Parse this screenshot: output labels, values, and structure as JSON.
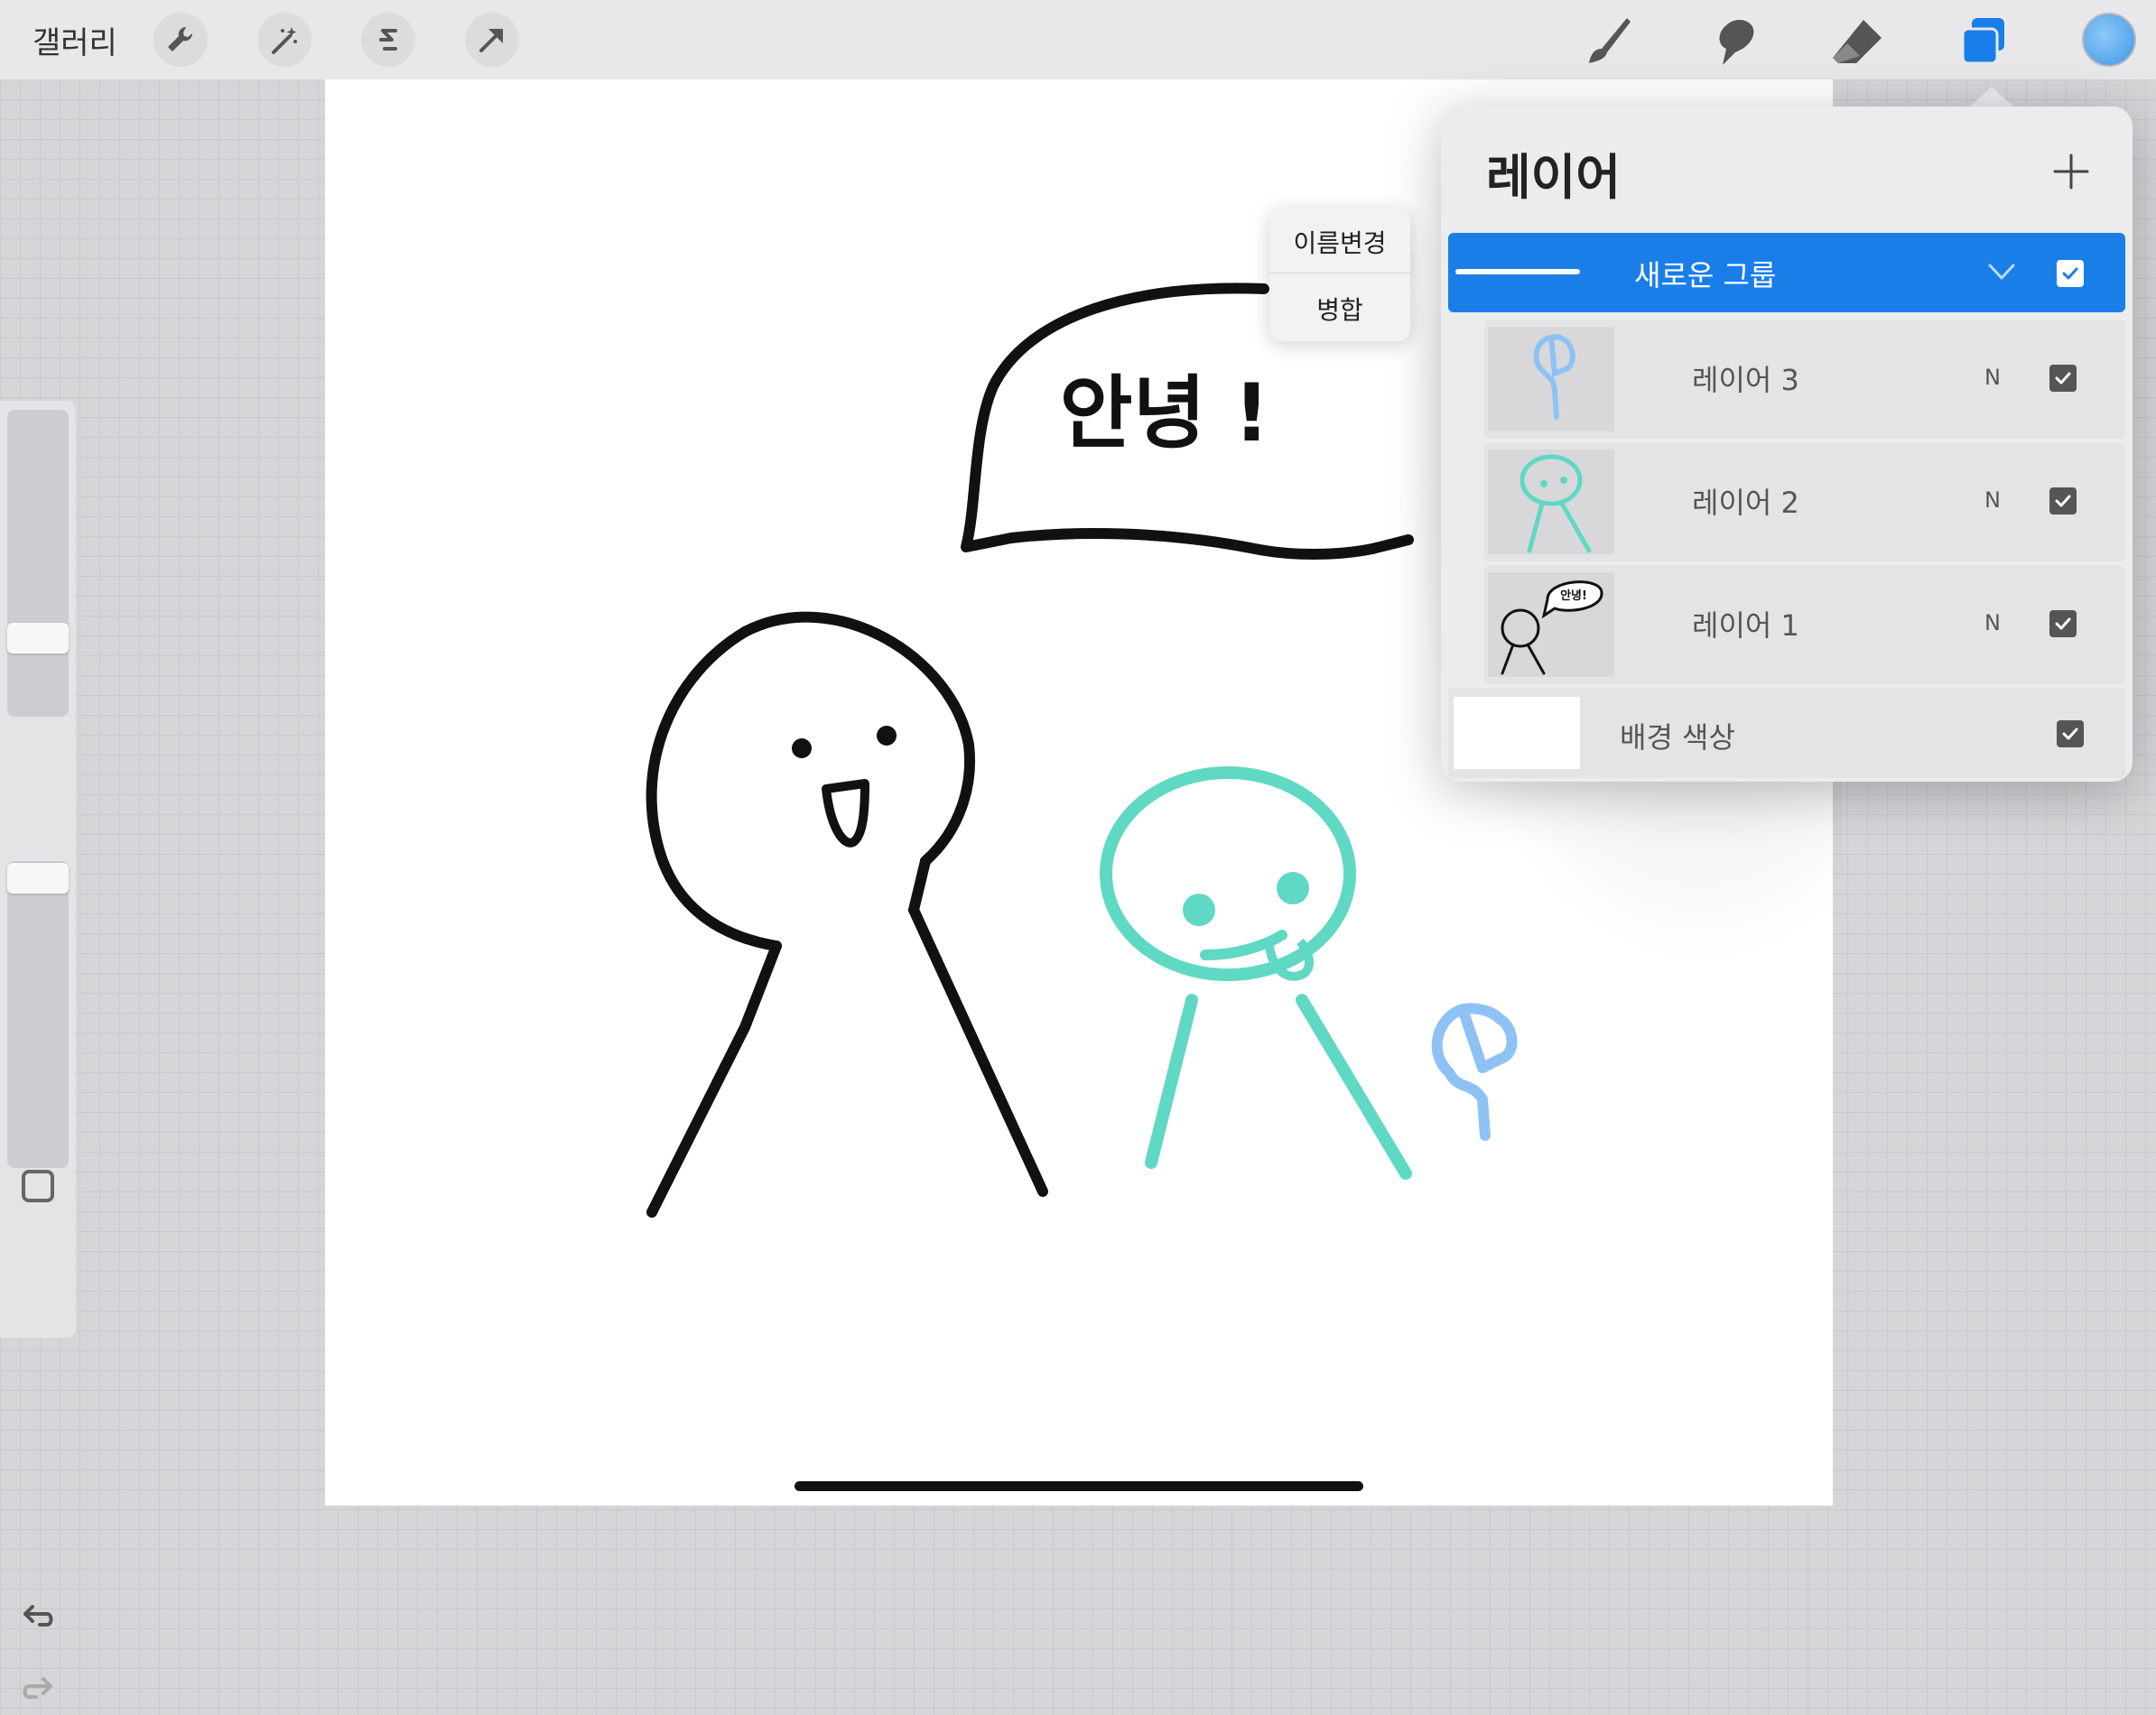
{
  "topbar": {
    "gallery_label": "갤러리",
    "left_tools": [
      "wrench-icon",
      "magic-wand-icon",
      "selection-icon",
      "move-arrow-icon"
    ],
    "right_tools": [
      "brush-icon",
      "smudge-icon",
      "eraser-icon",
      "layers-icon"
    ],
    "active_color": "#3e97e6"
  },
  "canvas": {
    "speech_text": "안녕 !"
  },
  "context_menu": {
    "items": [
      "이름변경",
      "병합"
    ]
  },
  "layers_panel": {
    "title": "레이어",
    "group": {
      "name": "새로운 그룹",
      "visible": true
    },
    "layers": [
      {
        "name": "레이어 3",
        "blend": "N",
        "visible": true
      },
      {
        "name": "레이어 2",
        "blend": "N",
        "visible": true
      },
      {
        "name": "레이어 1",
        "blend": "N",
        "visible": true
      }
    ],
    "background": {
      "name": "배경 색상",
      "visible": true
    }
  },
  "thumb_text": "안녕!"
}
